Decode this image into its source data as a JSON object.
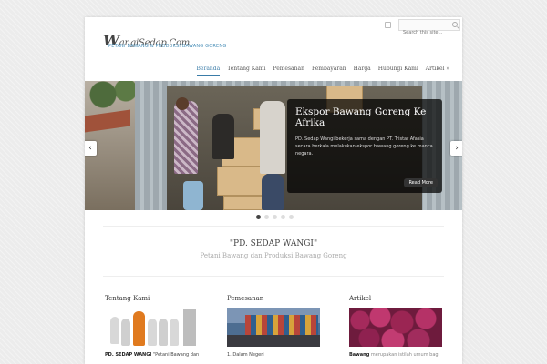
{
  "search": {
    "placeholder": "Search this site..."
  },
  "logo": {
    "title_initial": "W",
    "title_rest": "angiSedap.Com",
    "tagline": "PETANI BAWANG & PRODUKSI BAWANG GORENG"
  },
  "nav": {
    "items": [
      "Beranda",
      "Tentang Kami",
      "Pemesanan",
      "Pembayaran",
      "Harga",
      "Hubungi Kami",
      "Artikel »"
    ],
    "active_index": 0
  },
  "slider": {
    "title": "Ekspor Bawang Goreng Ke Afrika",
    "text": "PD. Sedap Wangi bekerja sama dengan PT. Tristar Afasia secara berkala melakukan ekspor bawang goreng ke manca negara.",
    "read_more": "Read More",
    "prev": "‹",
    "next": "›",
    "dot_count": 5,
    "active_dot": 0
  },
  "welcome": {
    "title": "\"PD. SEDAP WANGI\"",
    "subtitle": "Petani Bawang dan Produksi Bawang Goreng"
  },
  "columns": [
    {
      "title": "Tentang Kami",
      "text_bold": "PD. SEDAP WANGI",
      "text_rest": " \"Petani Bawang dan"
    },
    {
      "title": "Pemesanan",
      "text_bold": "",
      "text_rest": "1. Dalam Negeri"
    },
    {
      "title": "Artikel",
      "text_bold": "Bawang",
      "text_rest": " merupakan istilah umum bagi"
    }
  ],
  "colors": {
    "accent": "#3a7ca8",
    "tagline": "#4a8fb8"
  }
}
